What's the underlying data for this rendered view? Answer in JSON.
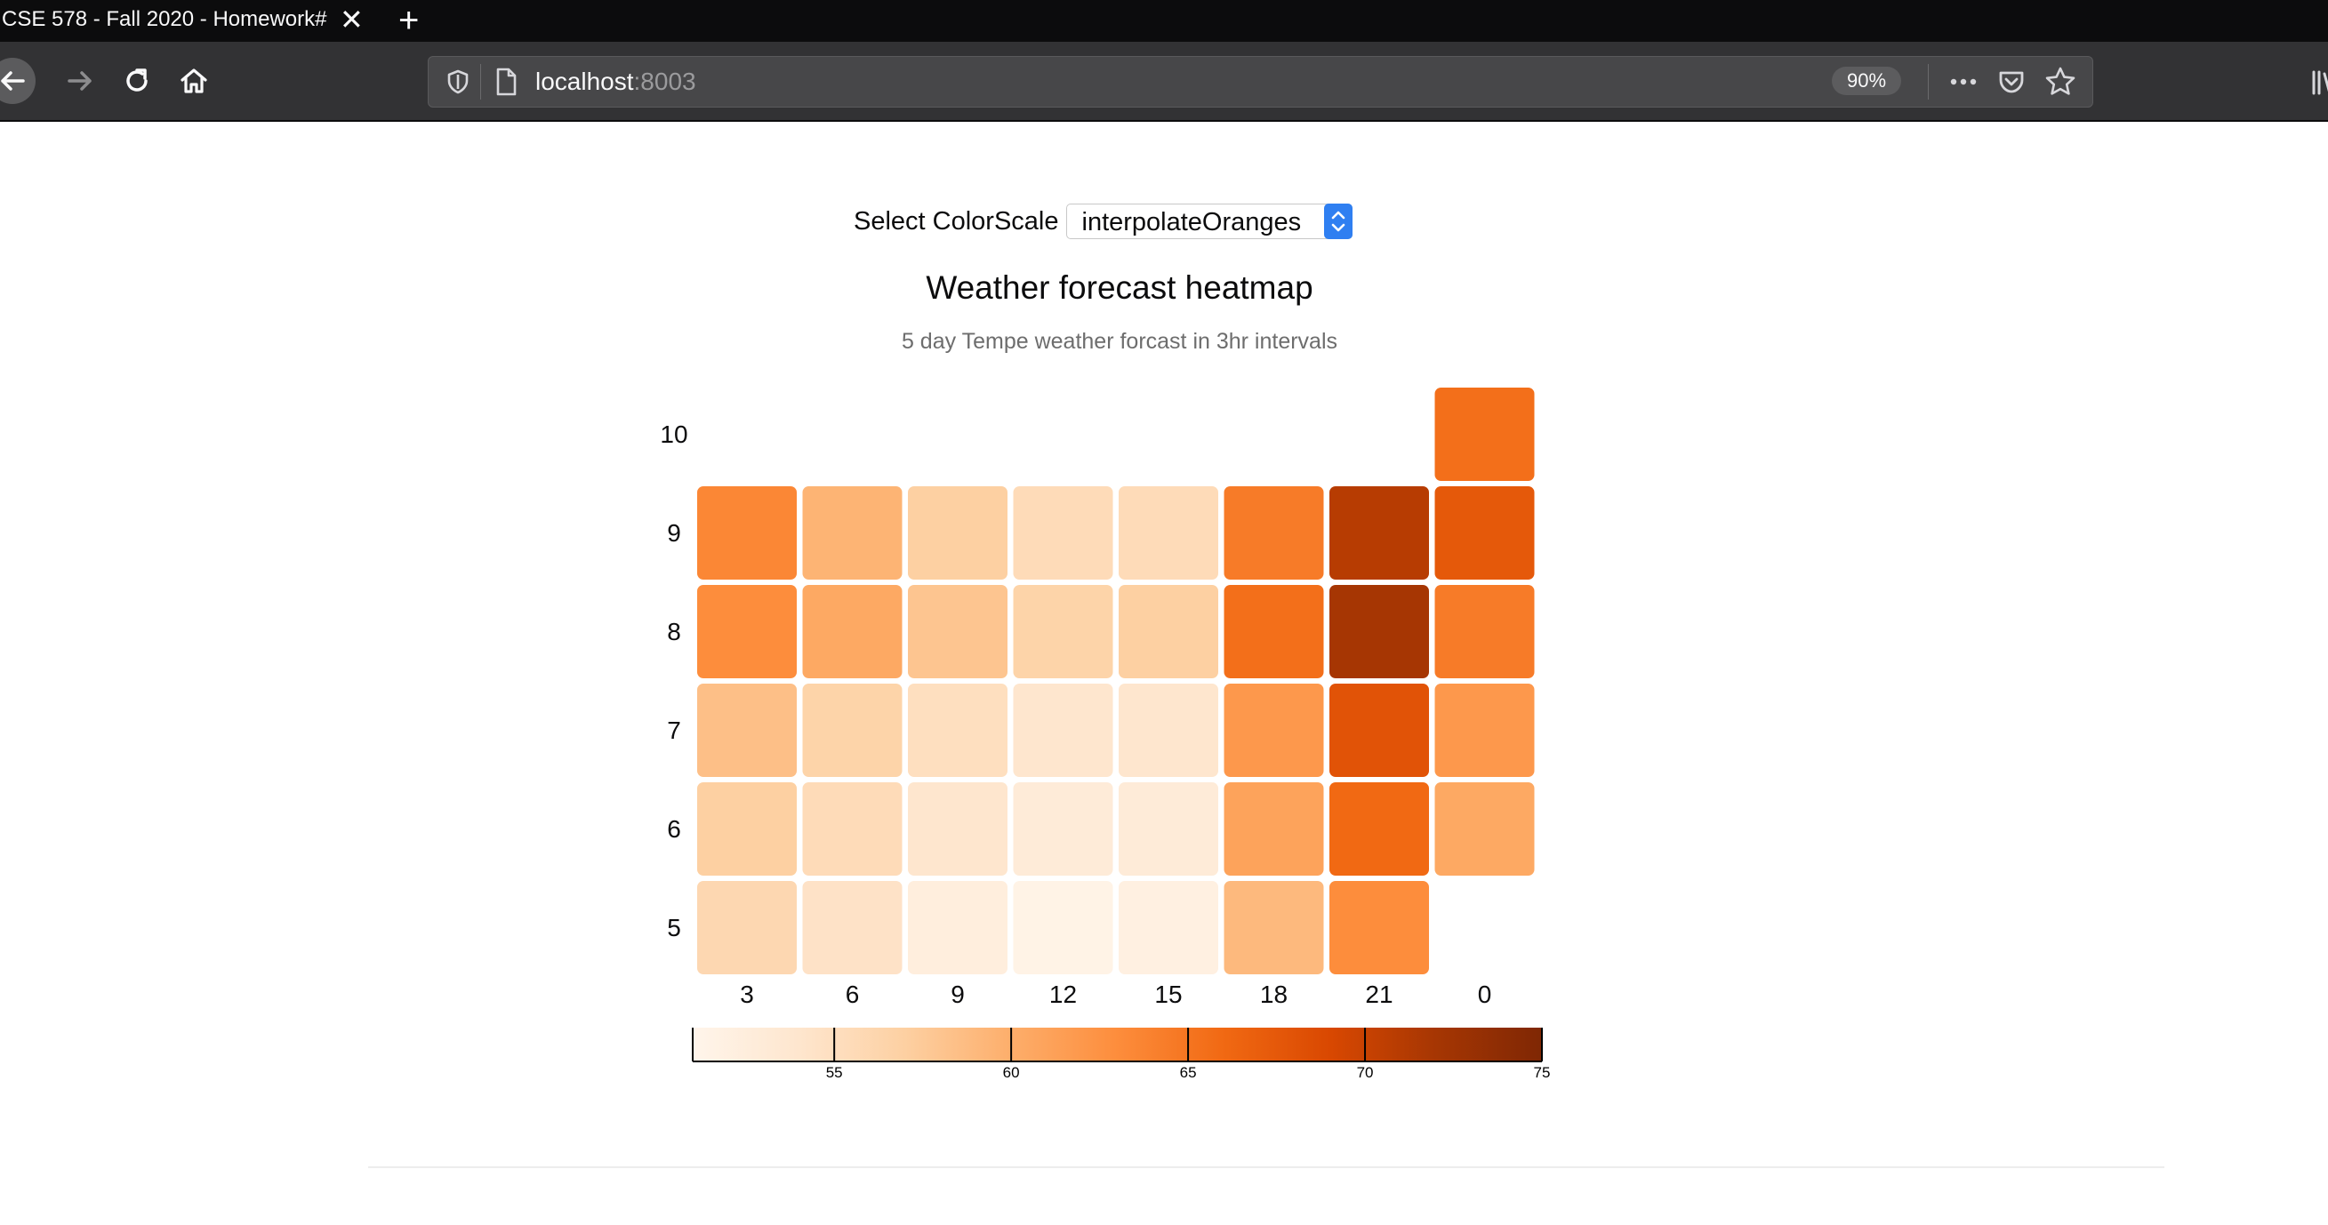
{
  "browser": {
    "tab_title": "CSE 578 - Fall 2020 - Homework#",
    "url_host": "localhost",
    "url_port": ":8003",
    "zoom": "90%"
  },
  "controls": {
    "select_label": "Select ColorScale",
    "select_value": "interpolateOranges"
  },
  "chart_data": {
    "type": "heatmap",
    "title": "Weather forecast heatmap",
    "subtitle": "5 day Tempe weather forcast in 3hr intervals",
    "x_categories": [
      "3",
      "6",
      "9",
      "12",
      "15",
      "18",
      "21",
      "0"
    ],
    "y_categories": [
      "10",
      "9",
      "8",
      "7",
      "6",
      "5"
    ],
    "color_scale": "interpolateOranges",
    "color_domain": [
      51,
      75
    ],
    "values": [
      [
        null,
        null,
        null,
        null,
        null,
        null,
        null,
        65.5
      ],
      [
        63.5,
        59.5,
        57,
        55.5,
        55.5,
        64.5,
        71,
        67.5
      ],
      [
        63.0,
        60.5,
        58,
        56.5,
        57,
        65.5,
        72,
        64.5
      ],
      [
        58.5,
        56.5,
        55,
        54,
        54,
        62,
        68,
        62
      ],
      [
        57,
        55.5,
        54,
        53,
        53,
        61,
        66,
        60.5
      ],
      [
        56,
        54.5,
        52.5,
        51.5,
        52,
        59,
        63,
        null
      ]
    ],
    "legend": {
      "ticks": [
        "55",
        "60",
        "65",
        "70",
        "75"
      ],
      "tick_values": [
        55,
        60,
        65,
        70,
        75
      ]
    }
  }
}
